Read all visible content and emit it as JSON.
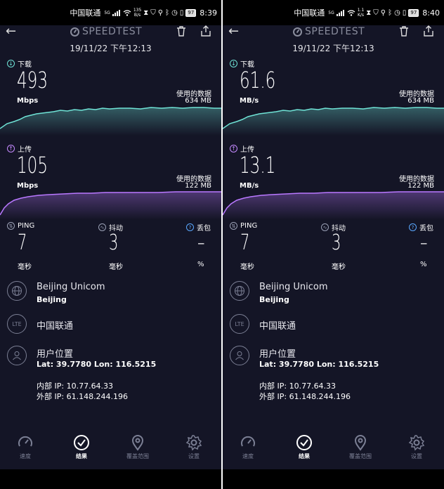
{
  "colors": {
    "download": "#6fe3d6",
    "upload": "#b978ff",
    "bg": "#141526",
    "muted": "#7b7f94"
  },
  "panels": [
    {
      "status": {
        "carrier": "中国联通",
        "sup": "5G",
        "rate_top": "135",
        "rate_bot": "B/s",
        "battery": "97",
        "time": "8:39"
      },
      "header": {
        "logo": "SPEEDTEST"
      },
      "datetime": "19/11/22 下午12:13",
      "download": {
        "label": "下载",
        "value": "493",
        "unit": "Mbps",
        "used_label": "使用的数据",
        "used_value": "634 MB"
      },
      "upload": {
        "label": "上传",
        "value": "105",
        "unit": "Mbps",
        "used_label": "使用的数据",
        "used_value": "122 MB"
      },
      "ping": {
        "label": "PING",
        "value": "7",
        "unit": "毫秒"
      },
      "jitter": {
        "label": "抖动",
        "value": "3",
        "unit": "毫秒"
      },
      "loss": {
        "label": "丢包",
        "value": "–",
        "unit": "%"
      },
      "provider": {
        "name": "Beijing Unicom",
        "city": "Beijing"
      },
      "network": {
        "badge": "LTE",
        "name": "中国联通"
      },
      "location": {
        "title": "用户位置",
        "coords": "Lat: 39.7780 Lon: 116.5215",
        "internal_ip": "内部 IP: 10.77.64.33",
        "external_ip": "外部 IP: 61.148.244.196"
      },
      "nav": [
        "速度",
        "结果",
        "覆盖范围",
        "设置"
      ]
    },
    {
      "status": {
        "carrier": "中国联通",
        "sup": "5G",
        "rate_top": "1.1",
        "rate_bot": "K/s",
        "battery": "97",
        "time": "8:40"
      },
      "header": {
        "logo": "SPEEDTEST"
      },
      "datetime": "19/11/22 下午12:13",
      "download": {
        "label": "下载",
        "value": "61.6",
        "unit": "MB/s",
        "used_label": "使用的数据",
        "used_value": "634 MB"
      },
      "upload": {
        "label": "上传",
        "value": "13.1",
        "unit": "MB/s",
        "used_label": "使用的数据",
        "used_value": "122 MB"
      },
      "ping": {
        "label": "PING",
        "value": "7",
        "unit": "毫秒"
      },
      "jitter": {
        "label": "抖动",
        "value": "3",
        "unit": "毫秒"
      },
      "loss": {
        "label": "丢包",
        "value": "–",
        "unit": "%"
      },
      "provider": {
        "name": "Beijing Unicom",
        "city": "Beijing"
      },
      "network": {
        "badge": "LTE",
        "name": "中国联通"
      },
      "location": {
        "title": "用户位置",
        "coords": "Lat: 39.7780 Lon: 116.5215",
        "internal_ip": "内部 IP: 10.77.64.33",
        "external_ip": "外部 IP: 61.148.244.196"
      },
      "nav": [
        "速度",
        "结果",
        "覆盖范围",
        "设置"
      ]
    }
  ]
}
